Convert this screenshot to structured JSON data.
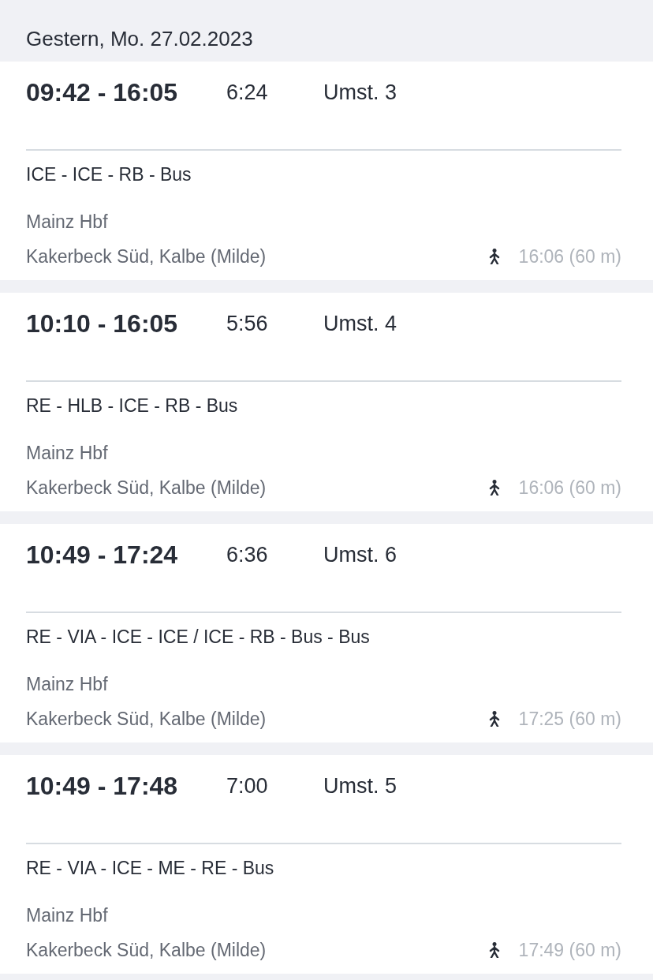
{
  "date_header": "Gestern, Mo. 27.02.2023",
  "connections": [
    {
      "times": "09:42 - 16:05",
      "duration": "6:24",
      "transfers": "Umst. 3",
      "products": "ICE - ICE - RB - Bus",
      "origin": "Mainz Hbf",
      "destination": "Kakerbeck Süd, Kalbe (Milde)",
      "walk": "16:06 (60 m)"
    },
    {
      "times": "10:10 - 16:05",
      "duration": "5:56",
      "transfers": "Umst. 4",
      "products": "RE - HLB - ICE - RB - Bus",
      "origin": "Mainz Hbf",
      "destination": "Kakerbeck Süd, Kalbe (Milde)",
      "walk": "16:06 (60 m)"
    },
    {
      "times": "10:49 - 17:24",
      "duration": "6:36",
      "transfers": "Umst. 6",
      "products": "RE - VIA - ICE - ICE / ICE - RB - Bus - Bus",
      "origin": "Mainz Hbf",
      "destination": "Kakerbeck Süd, Kalbe (Milde)",
      "walk": "17:25 (60 m)"
    },
    {
      "times": "10:49 - 17:48",
      "duration": "7:00",
      "transfers": "Umst. 5",
      "products": "RE - VIA - ICE - ME - RE - Bus",
      "origin": "Mainz Hbf",
      "destination": "Kakerbeck Süd, Kalbe (Milde)",
      "walk": "17:49 (60 m)"
    }
  ]
}
